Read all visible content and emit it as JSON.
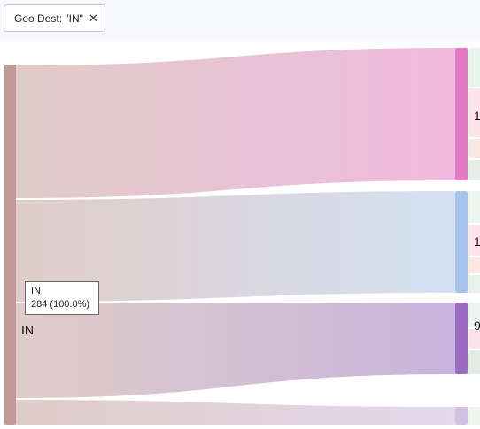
{
  "filter": {
    "label": "Geo Dest: \"IN\"",
    "close_glyph": "✕"
  },
  "source_node": {
    "label": "IN",
    "color": "#c09a94"
  },
  "tooltip": {
    "name": "IN",
    "value": "284 (100.0%)"
  },
  "targets": [
    {
      "label": "1",
      "color": "#e27bc3",
      "flow_color": "#efbade"
    },
    {
      "label": "1",
      "color": "#a8c4ea",
      "flow_color": "#d3e1f3"
    },
    {
      "label": "9",
      "color": "#9a6cc2",
      "flow_color": "#c8b4dc"
    },
    {
      "label": "",
      "color": "#d2c0e2",
      "flow_color": "#e3d8ec"
    }
  ],
  "colors": {
    "source_flow": "#e0ccc8",
    "background": "#ffffff",
    "filter_bar": "#f7f8fc"
  }
}
